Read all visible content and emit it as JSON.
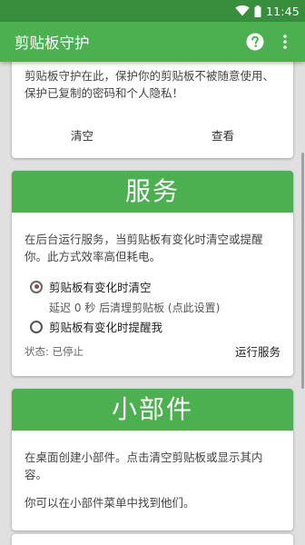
{
  "status_bar": {
    "time": "11:45",
    "icons": [
      "wifi-icon",
      "battery-icon"
    ]
  },
  "app_bar": {
    "title": "剪贴板守护",
    "actions": [
      "help-icon",
      "more-vert-icon"
    ],
    "color": "#4caf50"
  },
  "protect_card": {
    "description": "剪贴板守护在此，保护你的剪贴板不被随意使用、保护已复制的密码和个人隐私！",
    "clear_label": "清空",
    "view_label": "查看"
  },
  "service_card": {
    "title": "服务",
    "description": "在后台运行服务，当剪贴板有变化时清空或提醒你。此方式效率高但耗电。",
    "options": [
      {
        "label": "剪贴板有变化时清空",
        "selected": true,
        "sub": "延迟 0 秒 后清理剪贴板 (点此设置)"
      },
      {
        "label": "剪贴板有变化时提醒我",
        "selected": false
      }
    ],
    "status": "状态: 已停止",
    "run_label": "运行服务"
  },
  "widget_card": {
    "title": "小部件",
    "description": "在桌面创建小部件。点击清空剪贴板或显示其内容。",
    "hint": "你可以在小部件菜单中找到他们。"
  },
  "colors": {
    "primary": "#4caf50",
    "primary_dark": "#388e3c",
    "radio_selected": "#8d4a45"
  }
}
